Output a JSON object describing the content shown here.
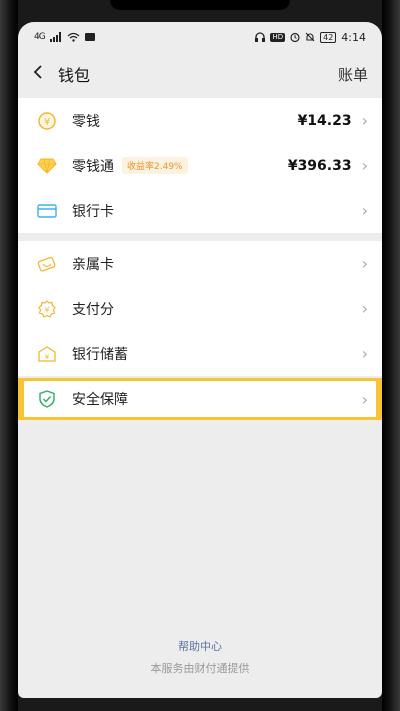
{
  "status": {
    "network": "4G",
    "time": "4:14",
    "battery": "42",
    "hd": "HD"
  },
  "nav": {
    "title": "钱包",
    "right": "账单"
  },
  "group1": [
    {
      "name": "零钱",
      "value": "¥14.23"
    },
    {
      "name": "零钱通",
      "badge": "收益率2.49%",
      "value": "¥396.33"
    },
    {
      "name": "银行卡"
    }
  ],
  "group2": [
    {
      "name": "亲属卡"
    },
    {
      "name": "支付分"
    },
    {
      "name": "银行储蓄"
    }
  ],
  "security": {
    "name": "安全保障"
  },
  "footer": {
    "help": "帮助中心",
    "provider": "本服务由财付通提供"
  },
  "colors": {
    "accent": "#f6c531",
    "link": "#5a74a6",
    "badge": "#e8962f"
  }
}
